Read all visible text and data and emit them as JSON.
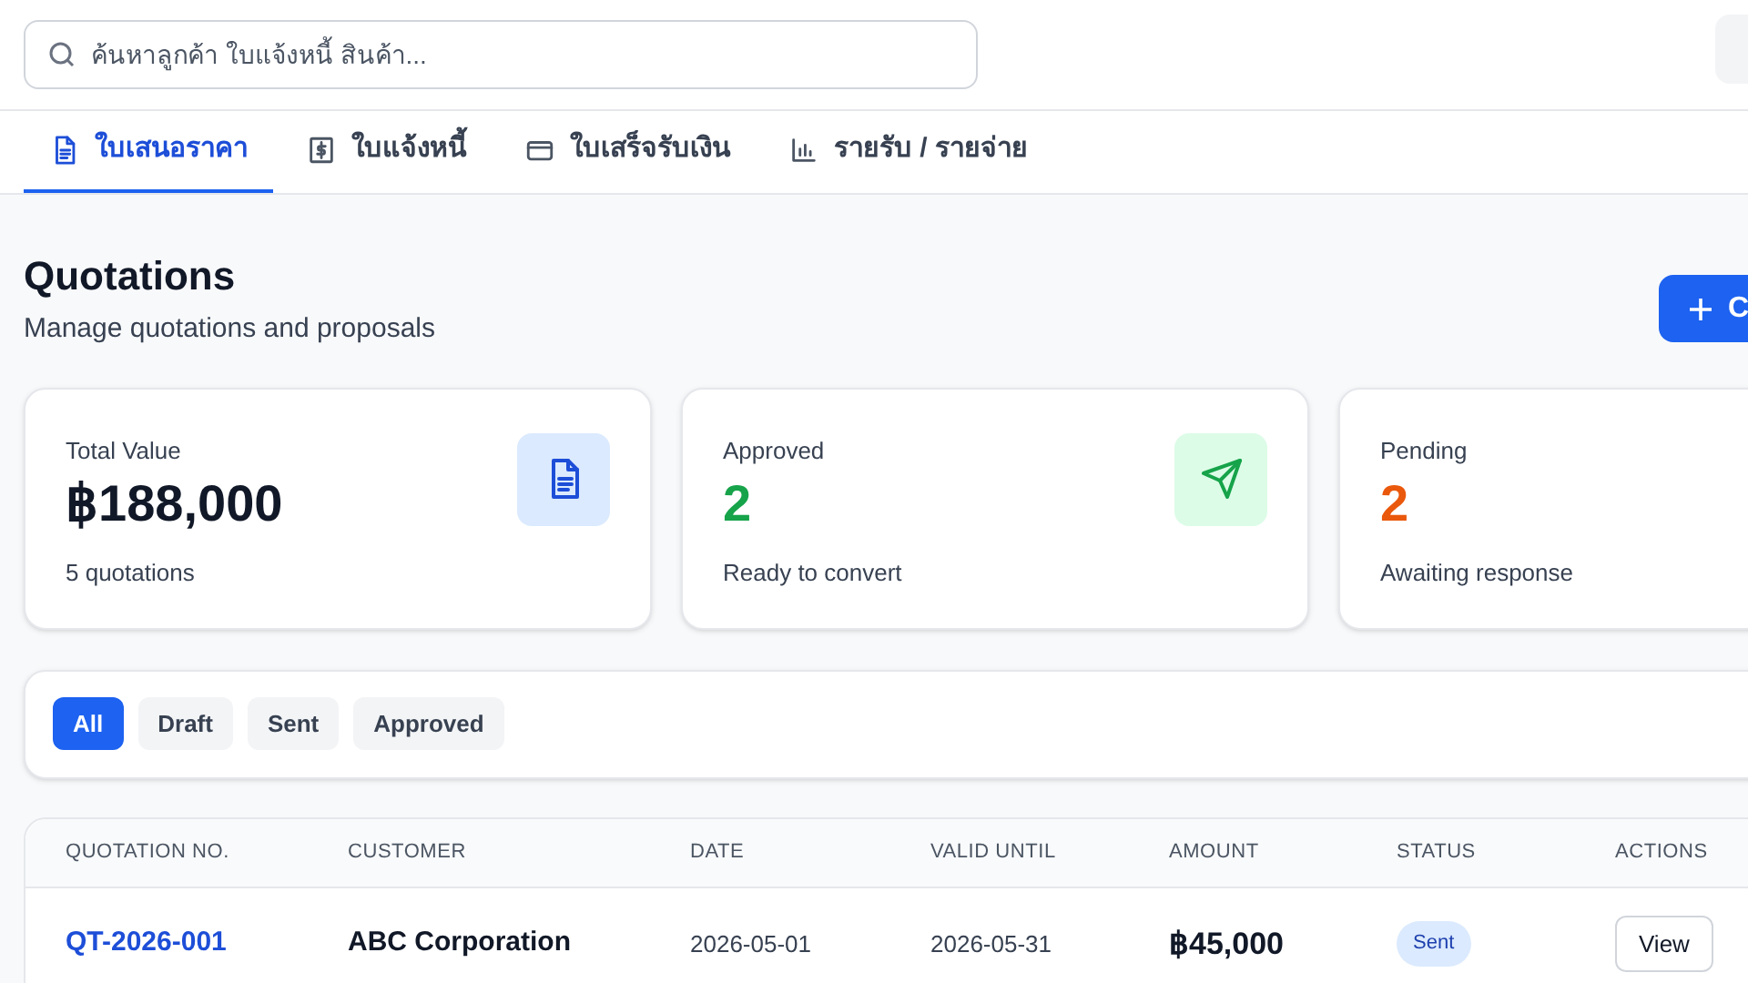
{
  "search": {
    "placeholder": "ค้นหาลูกค้า ใบแจ้งหนี้ สินค้า..."
  },
  "tabs": [
    {
      "label": "ใบเสนอราคา",
      "selected": true
    },
    {
      "label": "ใบแจ้งหนี้",
      "selected": false
    },
    {
      "label": "ใบเสร็จรับเงิน",
      "selected": false
    },
    {
      "label": "รายรับ / รายจ่าย",
      "selected": false
    }
  ],
  "page": {
    "title": "Quotations",
    "subtitle": "Manage quotations and proposals",
    "create_button": "C"
  },
  "stats": [
    {
      "kind": "total",
      "label": "Total Value",
      "value": "฿188,000",
      "note": "5 quotations"
    },
    {
      "kind": "approved",
      "label": "Approved",
      "value": "2",
      "note": "Ready to convert"
    },
    {
      "kind": "pending",
      "label": "Pending",
      "value": "2",
      "note": "Awaiting response"
    }
  ],
  "filters": [
    {
      "label": "All",
      "selected": true
    },
    {
      "label": "Draft",
      "selected": false
    },
    {
      "label": "Sent",
      "selected": false
    },
    {
      "label": "Approved",
      "selected": false
    }
  ],
  "table": {
    "columns": [
      "QUOTATION NO.",
      "CUSTOMER",
      "DATE",
      "VALID UNTIL",
      "AMOUNT",
      "STATUS",
      "ACTIONS"
    ],
    "rows": [
      {
        "number": "QT-2026-001",
        "customer": "ABC Corporation",
        "date": "2026-05-01",
        "valid_until": "2026-05-31",
        "amount": "฿45,000",
        "status": "Sent",
        "action": "View"
      }
    ]
  }
}
